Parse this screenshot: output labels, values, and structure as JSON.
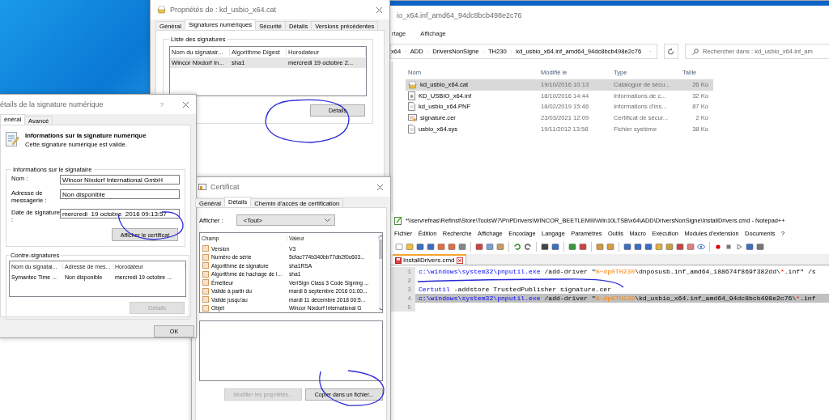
{
  "explorer": {
    "title": "io_x64.inf_amd64_94dc8bcb498e2c76",
    "ribbon_tabs": [
      "rtage",
      "Affichage"
    ],
    "breadcrumb": [
      "x64",
      "ADD",
      "DriversNonSigne",
      "TH230",
      "kd_usbio_x64.inf_amd64_94dc8bcb498e2c76"
    ],
    "search": {
      "placeholder": "Rechercher dans : kd_usbio_x64.inf_am"
    },
    "columns": [
      "Nom",
      "Modifié le",
      "Type",
      "Taille"
    ],
    "rows": [
      {
        "kind": "catalog",
        "name": "kd_usbio_x64.cat",
        "modified": "19/10/2016 10:13",
        "type": "Catalogue de sécu...",
        "size": "26 Ko",
        "selected": true
      },
      {
        "kind": "setup",
        "name": "KD_USBIO_x64.inf",
        "modified": "18/10/2016 14:44",
        "type": "Informations de c...",
        "size": "32 Ko",
        "selected": false
      },
      {
        "kind": "document",
        "name": "kd_usbio_x64.PNF",
        "modified": "18/02/2019 15:46",
        "type": "Informations d'ins...",
        "size": "87 Ko",
        "selected": false
      },
      {
        "kind": "certificate",
        "name": "signature.cer",
        "modified": "23/03/2021 12:09",
        "type": "Certificat de sécur...",
        "size": "2 Ko",
        "selected": false
      },
      {
        "kind": "document",
        "name": "usbio_x64.sys",
        "modified": "19/11/2012 13:58",
        "type": "Fichier système",
        "size": "38 Ko",
        "selected": false
      }
    ]
  },
  "properties": {
    "title": "Propriétés de : kd_usbio_x64.cat",
    "tabs": [
      {
        "label": "Général",
        "selected": false
      },
      {
        "label": "Signatures numériques",
        "selected": true
      },
      {
        "label": "Sécurité",
        "selected": false
      },
      {
        "label": "Détails",
        "selected": false
      },
      {
        "label": "Versions précédentes",
        "selected": false
      }
    ],
    "group": "Liste des signatures",
    "columns": [
      "Nom du signatair...",
      "Algorithme Digest",
      "Horodateur"
    ],
    "rows": [
      {
        "cells": [
          "Wincor Nixdorf In...",
          "sha1",
          "mercredi 19 octobre 2..."
        ],
        "selected": true
      }
    ],
    "details_button": "Détails"
  },
  "signature_details": {
    "title": "étails de la signature numérique",
    "help": "?",
    "tabs": [
      {
        "label": "énéral",
        "selected": true
      },
      {
        "label": "Avancé",
        "selected": false
      }
    ],
    "heading": "Informations sur la signature numérique",
    "status": "Cette signature numérique est valide.",
    "signer_group": "Informations sur le signataire",
    "fields": [
      {
        "label": "Nom :",
        "value": "Wincor Nixdorf International GmbH"
      },
      {
        "label": "Adresse de messagerie :",
        "value": "Non disponible"
      },
      {
        "label": "Date de signature :",
        "value": "mercredi  19 octobre  2016 09:13:57"
      }
    ],
    "view_certificate_button": "Afficher le certificat",
    "countersign_group": "Contre-signatures",
    "columns": [
      "Nom du signatai...",
      "Adresse de mes...",
      "Horodateur"
    ],
    "rows": [
      {
        "cells": [
          "Symantec Time ...",
          "Non disponible",
          "mercredi 19 octobre ..."
        ],
        "selected": false
      }
    ],
    "details_button": {
      "label": "Détails",
      "disabled": true
    },
    "ok_button": "OK"
  },
  "certificate": {
    "title": "Certificat",
    "tabs": [
      {
        "label": "Général",
        "selected": false
      },
      {
        "label": "Détails",
        "selected": true
      },
      {
        "label": "Chemin d'accès de certification",
        "selected": false
      }
    ],
    "show_label": "Afficher :",
    "show_value": "<Tout>",
    "columns": [
      "Champ",
      "Valeur"
    ],
    "rows": [
      {
        "field": "Version",
        "value": "V3"
      },
      {
        "field": "Numéro de série",
        "value": "5cfac774b340bb77db2f0c603..."
      },
      {
        "field": "Algorithme de signature",
        "value": "sha1RSA"
      },
      {
        "field": "Algorithme de hachage de l...",
        "value": "sha1"
      },
      {
        "field": "Émetteur",
        "value": "VeriSign Class 3 Code Signing ..."
      },
      {
        "field": "Valide à partir du",
        "value": "mardi 6 septembre 2016 01:00..."
      },
      {
        "field": "Valide jusqu'au",
        "value": "mardi 11 décembre 2018 00:5..."
      },
      {
        "field": "Objet",
        "value": "Wincor Nixdorf International G"
      }
    ],
    "buttons": [
      {
        "label": "Modifier les propriétés...",
        "disabled": true
      },
      {
        "label": "Copier dans un fichier...",
        "disabled": false
      }
    ]
  },
  "notepad": {
    "title": "*\\\\servrefnas\\RefInst\\Store\\ToolsW7\\PnPDrivers\\WINCOR_BEETLEMIII\\Win10LTSB\\x64\\ADD\\DriversNonSigne\\InstallDrivers.cmd - Notepad++",
    "menu": [
      "Fichier",
      "Édition",
      "Recherche",
      "Affichage",
      "Encodage",
      "Langage",
      "Paramètres",
      "Outils",
      "Macro",
      "Exécution",
      "Modules d'extension",
      "Documents",
      "?"
    ],
    "tab": {
      "label": "InstallDrivers.cmd",
      "modified": true
    },
    "lines": [
      {
        "number": "1",
        "selected": false,
        "tokens": [
          {
            "kind": "command",
            "text": "c:\\windows\\system32\\pnputil.exe"
          },
          {
            "kind": "plain",
            "text": " /add-driver \""
          },
          {
            "kind": "variable",
            "text": "%~dp0TH230"
          },
          {
            "kind": "plain",
            "text": "\\dnposusb.inf_amd64_188674f869f382dd\\"
          },
          {
            "kind": "operator",
            "text": "*"
          },
          {
            "kind": "plain",
            "text": ".inf\" /s"
          }
        ]
      },
      {
        "number": "2",
        "selected": false
      },
      {
        "number": "3",
        "selected": false,
        "tokens": [
          {
            "kind": "command",
            "text": "Certutil"
          },
          {
            "kind": "plain",
            "text": " -addstore TrustedPublisher signature.cer"
          }
        ]
      },
      {
        "number": "4",
        "selected": true,
        "tokens": [
          {
            "kind": "command",
            "text": "c:\\windows\\system32\\pnputil.exe"
          },
          {
            "kind": "plain",
            "text": " /add-driver \""
          },
          {
            "kind": "variable",
            "text": "%~dp0TH230"
          },
          {
            "kind": "plain",
            "text": "\\kd_usbio_x64.inf_amd64_94dc8bcb498e2c76\\"
          },
          {
            "kind": "operator",
            "text": "*"
          },
          {
            "kind": "plain",
            "text": ".inf"
          }
        ]
      },
      {
        "number": "5",
        "selected": false
      }
    ]
  }
}
